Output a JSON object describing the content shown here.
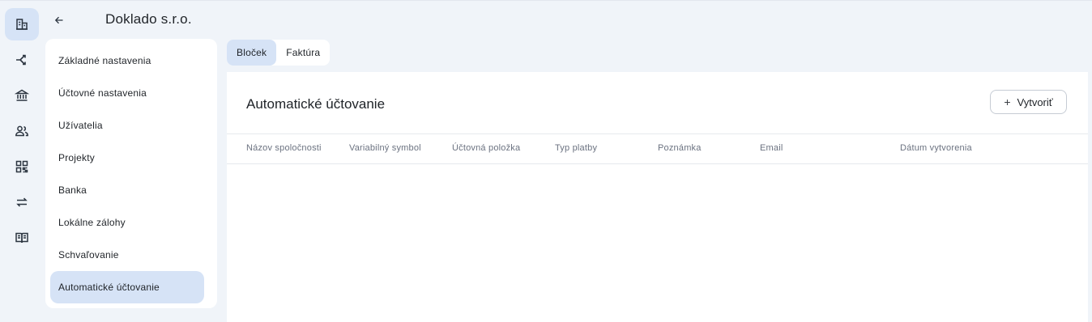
{
  "rail": {
    "items": [
      {
        "icon": "building-icon",
        "active": true
      },
      {
        "icon": "share-flow-icon",
        "active": false
      },
      {
        "icon": "bank-icon",
        "active": false
      },
      {
        "icon": "users-icon",
        "active": false
      },
      {
        "icon": "qr-code-icon",
        "active": false
      },
      {
        "icon": "transfer-icon",
        "active": false
      },
      {
        "icon": "book-icon",
        "active": false
      }
    ]
  },
  "header": {
    "company": "Doklado s.r.o."
  },
  "menu": {
    "items": [
      {
        "label": "Základné nastavenia"
      },
      {
        "label": "Účtovné nastavenia"
      },
      {
        "label": "Užívatelia"
      },
      {
        "label": "Projekty"
      },
      {
        "label": "Banka"
      },
      {
        "label": "Lokálne zálohy"
      },
      {
        "label": "Schvaľovanie"
      },
      {
        "label": "Automatické účtovanie",
        "active": true
      }
    ]
  },
  "tabs": [
    {
      "label": "Bloček",
      "active": true
    },
    {
      "label": "Faktúra",
      "active": false
    }
  ],
  "main": {
    "title": "Automatické účtovanie",
    "create_label": "Vytvoriť",
    "columns": [
      "Názov spoločnosti",
      "Variabilný symbol",
      "Účtovná položka",
      "Typ platby",
      "Poznámka",
      "Email",
      "Dátum vytvorenia"
    ]
  },
  "colors": {
    "active_bg": "#d6e3f6",
    "page_bg": "#f0f4f9"
  }
}
